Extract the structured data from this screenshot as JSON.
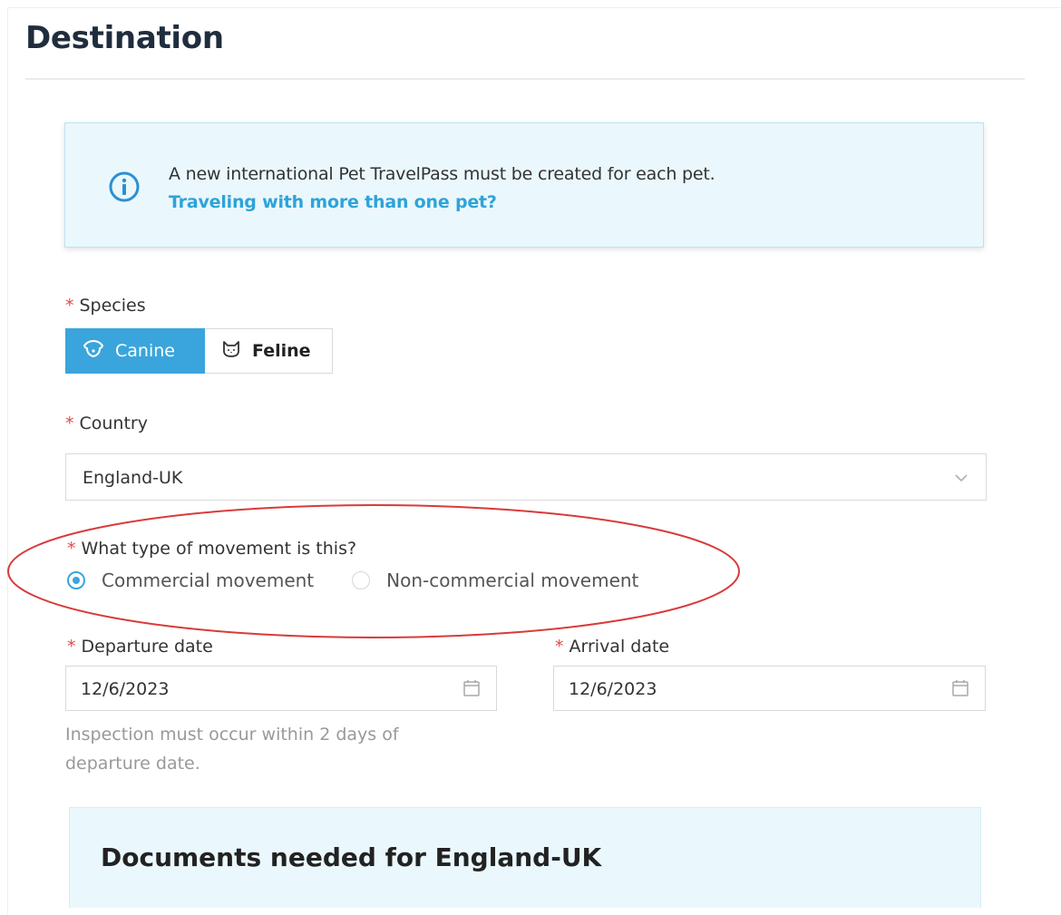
{
  "page": {
    "title": "Destination"
  },
  "info_banner": {
    "text": "A new international Pet TravelPass must be created for each pet.",
    "link": "Traveling with more than one pet?",
    "icon": "info-icon"
  },
  "species": {
    "required_mark": "*",
    "label": "Species",
    "options": [
      {
        "label": "Canine",
        "icon": "dog-icon",
        "selected": true
      },
      {
        "label": "Feline",
        "icon": "cat-icon",
        "selected": false
      }
    ]
  },
  "country": {
    "required_mark": "*",
    "label": "Country",
    "value": "England-UK",
    "icon": "chevron-down-icon"
  },
  "movement": {
    "required_mark": "*",
    "label": "What type of movement is this?",
    "options": [
      {
        "label": "Commercial movement",
        "selected": true
      },
      {
        "label": "Non-commercial movement",
        "selected": false
      }
    ]
  },
  "departure": {
    "required_mark": "*",
    "label": "Departure date",
    "value": "12/6/2023",
    "help": "Inspection must occur within 2 days of departure date."
  },
  "arrival": {
    "required_mark": "*",
    "label": "Arrival date",
    "value": "12/6/2023"
  },
  "documents": {
    "title": "Documents needed for England-UK"
  },
  "colors": {
    "accent": "#3aa5dc",
    "required": "#e24a4a",
    "annotation_ellipse": "#d93a3a",
    "info_background": "#eaf8fd"
  }
}
